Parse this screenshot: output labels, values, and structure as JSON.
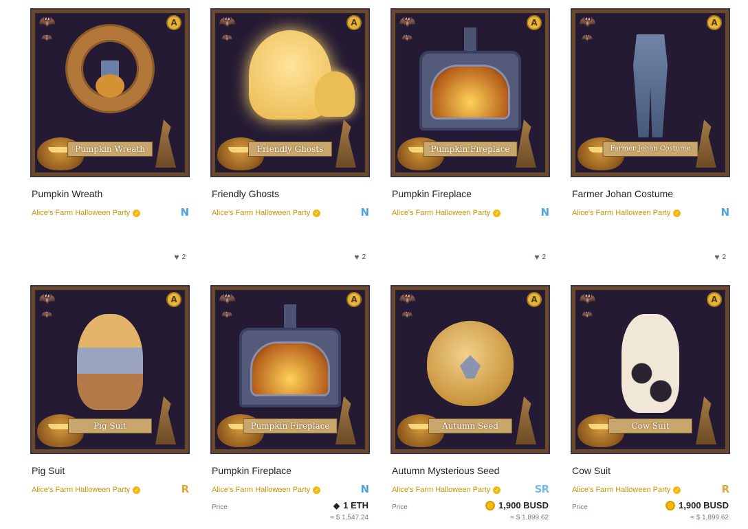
{
  "cards": [
    {
      "title": "Pumpkin Wreath",
      "banner": "Pumpkin Wreath",
      "collection": "Alice's Farm Halloween Party",
      "rarity": "N",
      "likes": "2"
    },
    {
      "title": "Friendly Ghosts",
      "banner": "Friendly Ghosts",
      "collection": "Alice's Farm Halloween Party",
      "rarity": "N",
      "likes": "2"
    },
    {
      "title": "Pumpkin Fireplace",
      "banner": "Pumpkin Fireplace",
      "collection": "Alice's Farm Halloween Party",
      "rarity": "N",
      "likes": "2"
    },
    {
      "title": "Farmer Johan Costume",
      "banner": "Farmer Johan Costume",
      "collection": "Alice's Farm Halloween Party",
      "rarity": "N",
      "likes": "2"
    },
    {
      "title": "Pig Suit",
      "banner": "Pig Suit",
      "collection": "Alice's Farm Halloween Party",
      "rarity": "R"
    },
    {
      "title": "Pumpkin Fireplace",
      "banner": "Pumpkin Fireplace",
      "collection": "Alice's Farm Halloween Party",
      "rarity": "N",
      "price_label": "Price",
      "price": "1 ETH",
      "fiat": "≈ $ 1,547.24"
    },
    {
      "title": "Autumn Mysterious Seed",
      "banner": "Autumn Seed",
      "collection": "Alice's Farm Halloween Party",
      "rarity": "SR",
      "price_label": "Price",
      "price": "1,900 BUSD",
      "fiat": "≈ $ 1,899.62"
    },
    {
      "title": "Cow Suit",
      "banner": "Cow Suit",
      "collection": "Alice's Farm Halloween Party",
      "rarity": "R",
      "price_label": "Price",
      "price": "1,900 BUSD",
      "fiat": "≈ $ 1,899.62"
    }
  ],
  "icons": {
    "bat": "bat-icon",
    "verified": "verified-badge-icon",
    "heart": "heart-icon",
    "eth": "eth-icon",
    "busd": "busd-icon"
  },
  "colors": {
    "collection_text": "#c99400",
    "rarity_n": "#4fa3e0",
    "rarity_r": "#d8a83a",
    "rarity_sr": "#79b8e6",
    "art_background": "#241a33"
  }
}
